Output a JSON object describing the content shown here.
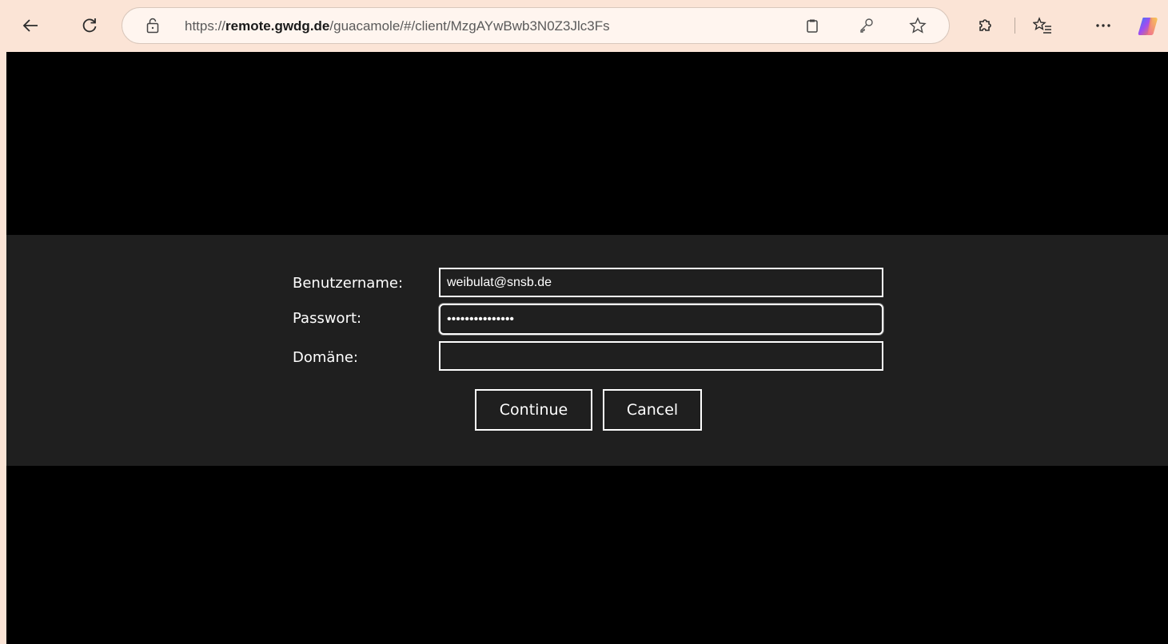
{
  "browser": {
    "url_prefix": "https://",
    "url_host": "remote.gwdg.de",
    "url_path": "/guacamole/#/client/MzgAYwBwb3N0Z3Jlc3Fs",
    "icons": [
      "back-icon",
      "refresh-icon",
      "site-info-icon",
      "clipboard-icon",
      "key-icon",
      "favorite-star-icon",
      "extensions-icon",
      "favorites-list-icon",
      "more-icon",
      "copilot-icon"
    ]
  },
  "login_form": {
    "username_label": "Benutzername:",
    "username_value": "weibulat@snsb.de",
    "password_label": "Passwort:",
    "password_value": "•••••••••••••••",
    "domain_label": "Domäne:",
    "domain_value": "",
    "continue_label": "Continue",
    "cancel_label": "Cancel"
  },
  "colors": {
    "browser_chrome": "#fbe4d6",
    "viewport_bg": "#000000",
    "dialog_bg": "#1f1f1f",
    "text": "#ffffff"
  }
}
